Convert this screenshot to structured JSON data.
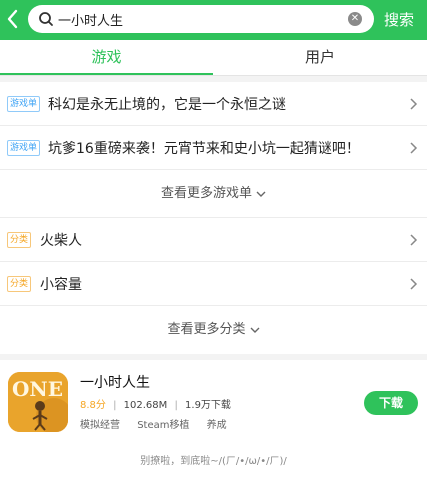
{
  "search": {
    "query": "一小时人生",
    "button_label": "搜索"
  },
  "tabs": [
    {
      "label": "游戏",
      "active": true
    },
    {
      "label": "用户",
      "active": false
    }
  ],
  "game_lists": [
    {
      "tag": "游戏单",
      "title": "科幻是永无止境的，它是一个永恒之谜"
    },
    {
      "tag": "游戏单",
      "title": "坑爹16重磅来袭！元宵节来和史小坑一起猜谜吧！"
    }
  ],
  "more_game_lists": "查看更多游戏单",
  "categories": [
    {
      "tag": "分类",
      "title": "火柴人"
    },
    {
      "tag": "分类",
      "title": "小容量"
    }
  ],
  "more_categories": "查看更多分类",
  "app": {
    "icon_text": "ONE",
    "name": "一小时人生",
    "score": "8.8分",
    "size": "102.68M",
    "downloads": "1.9万下载",
    "tags": [
      "模拟经营",
      "Steam移植",
      "养成"
    ],
    "download_label": "下载"
  },
  "footer": "别撩啦，到底啦~/(ㄏ/•/ω/•/ㄏ)/",
  "colors": {
    "accent": "#2fc25b",
    "tag_blue": "#42a5f5",
    "tag_orange": "#f5a623"
  }
}
